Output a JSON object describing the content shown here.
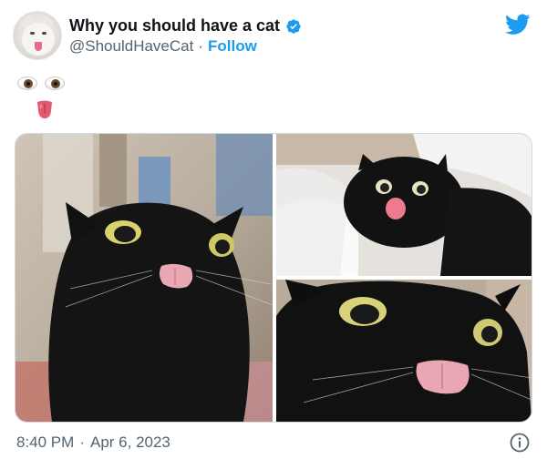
{
  "author": {
    "display_name": "Why you should have a cat",
    "handle": "@ShouldHaveCat",
    "separator": "·",
    "follow_label": "Follow",
    "verified": true
  },
  "tweet": {
    "emoji_text": [
      "eyes-emoji",
      "tongue-emoji"
    ]
  },
  "media": {
    "photos": [
      {
        "subject": "black-cat-tongue-out-closeup"
      },
      {
        "subject": "black-cat-in-bed-tongue-out"
      },
      {
        "subject": "black-cat-wide-eyes-tongue-out"
      }
    ]
  },
  "footer": {
    "time": "8:40 PM",
    "separator": "·",
    "date": "Apr 6, 2023"
  },
  "icons": {
    "brand_color": "#1d9bf0",
    "verified_color": "#1d9bf0",
    "twitter_logo": "twitter-bird-icon",
    "info": "info-icon"
  }
}
